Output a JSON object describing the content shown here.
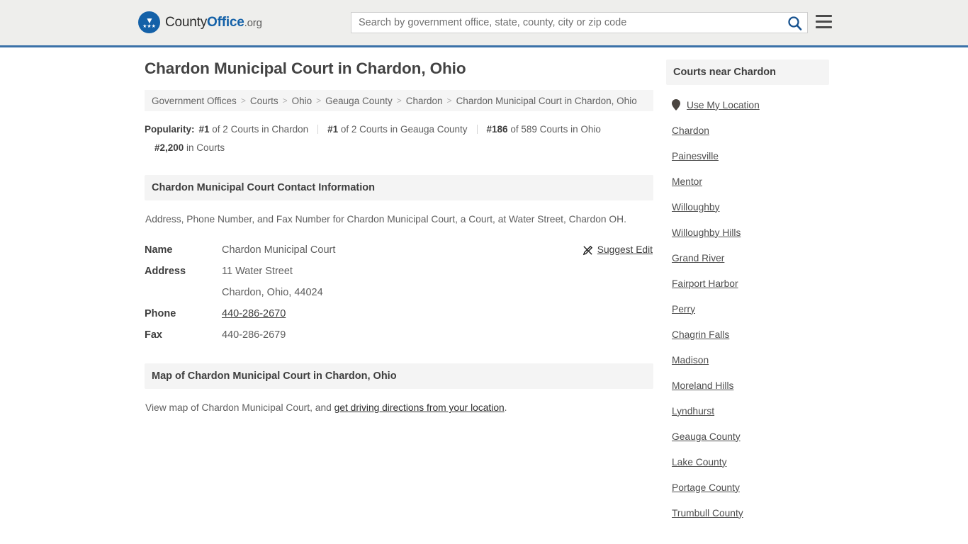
{
  "header": {
    "logo": {
      "name_part1": "County",
      "name_part2": "Office",
      "suffix": ".org",
      "icon": "eagle-shield-logo"
    },
    "search": {
      "placeholder": "Search by government office, state, county, city or zip code",
      "value": "",
      "icon": "search-icon"
    },
    "menu_icon": "hamburger-menu-icon",
    "accent_color": "#3a71a8"
  },
  "main": {
    "title": "Chardon Municipal Court in Chardon, Ohio",
    "breadcrumb": {
      "separator": ">",
      "items": [
        "Government Offices",
        "Courts",
        "Ohio",
        "Geauga County",
        "Chardon",
        "Chardon Municipal Court in Chardon, Ohio"
      ]
    },
    "popularity": {
      "label": "Popularity:",
      "items": [
        {
          "rank": "#1",
          "rest": "of 2 Courts in Chardon"
        },
        {
          "rank": "#1",
          "rest": "of 2 Courts in Geauga County"
        },
        {
          "rank": "#186",
          "rest": "of 589 Courts in Ohio"
        },
        {
          "rank": "#2,200",
          "rest": "in Courts"
        }
      ]
    },
    "contact": {
      "heading": "Chardon Municipal Court Contact Information",
      "description": "Address, Phone Number, and Fax Number for Chardon Municipal Court, a Court, at Water Street, Chardon OH.",
      "rows": [
        {
          "key": "Name",
          "value": "Chardon Municipal Court",
          "link": false
        },
        {
          "key": "Address",
          "value": "11 Water Street",
          "link": false
        },
        {
          "key": "",
          "value": "Chardon, Ohio, 44024",
          "link": false
        },
        {
          "key": "Phone",
          "value": "440-286-2670",
          "link": true
        },
        {
          "key": "Fax",
          "value": "440-286-2679",
          "link": false
        }
      ],
      "suggest_edit": {
        "label": "Suggest Edit",
        "icon": "pencil-edit-icon"
      }
    },
    "map": {
      "heading": "Map of Chardon Municipal Court in Chardon, Ohio",
      "desc_before": "View map of Chardon Municipal Court, and ",
      "desc_link": "get driving directions from your location",
      "desc_after": "."
    }
  },
  "sidebar": {
    "heading": "Courts near Chardon",
    "use_my_location": {
      "label": "Use My Location",
      "icon": "map-pin-icon"
    },
    "items": [
      "Chardon",
      "Painesville",
      "Mentor",
      "Willoughby",
      "Willoughby Hills",
      "Grand River",
      "Fairport Harbor",
      "Perry",
      "Chagrin Falls",
      "Madison",
      "Moreland Hills",
      "Lyndhurst",
      "Geauga County",
      "Lake County",
      "Portage County",
      "Trumbull County"
    ]
  }
}
